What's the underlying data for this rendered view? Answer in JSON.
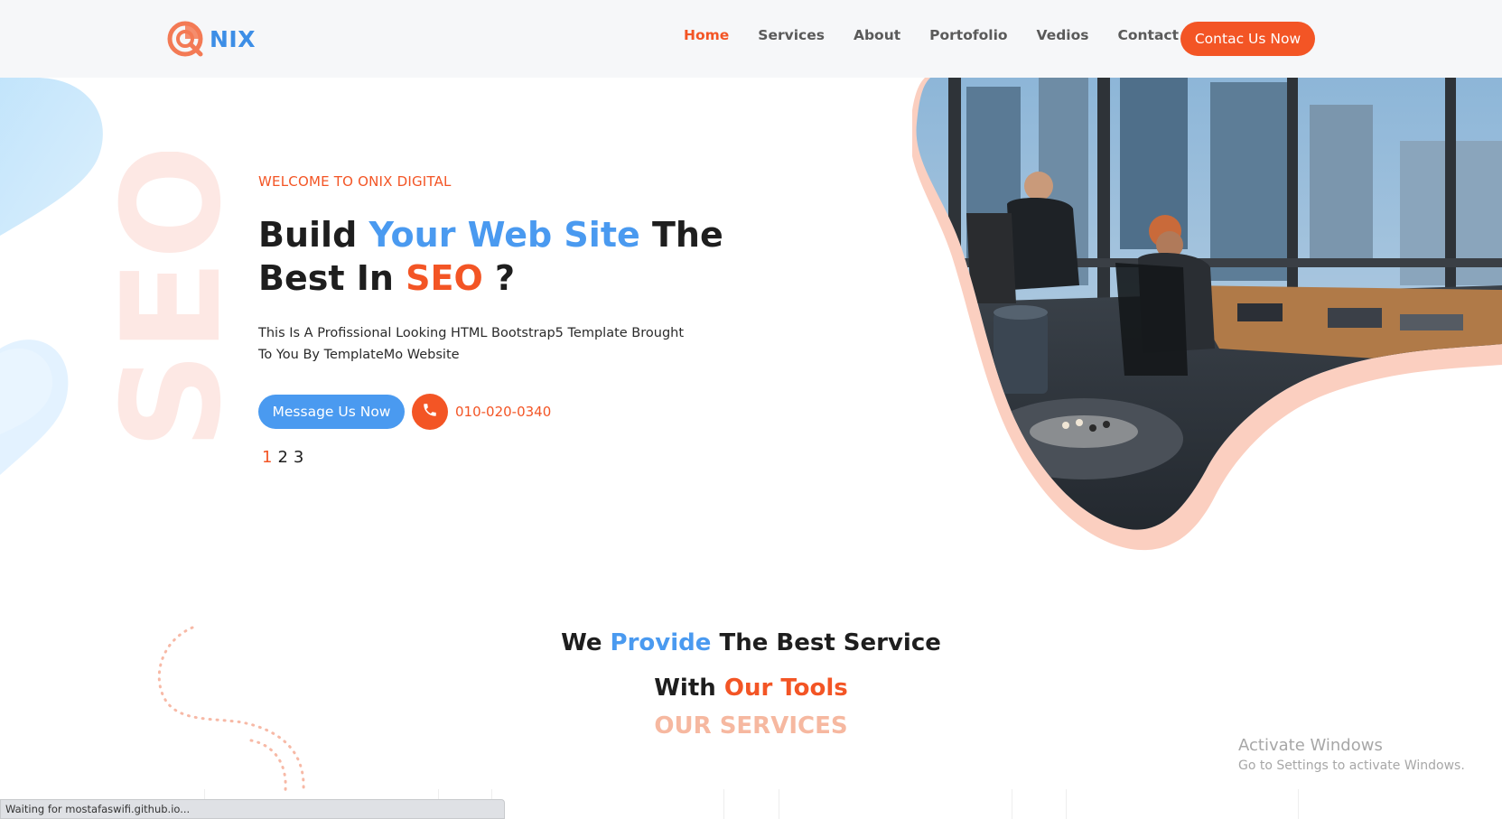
{
  "brand": {
    "logo_text": "NIX",
    "logo_icon": "magnifier-donut-icon"
  },
  "nav": {
    "items": [
      {
        "label": "Home",
        "active": true
      },
      {
        "label": "Services",
        "active": false
      },
      {
        "label": "About",
        "active": false
      },
      {
        "label": "Portofolio",
        "active": false
      },
      {
        "label": "Vedios",
        "active": false
      },
      {
        "label": "Contact Us",
        "active": false
      }
    ],
    "cta_label": "Contac Us Now"
  },
  "hero": {
    "kicker": "WELCOME TO ONIX DIGITAL",
    "headline": {
      "p1": "Build ",
      "p2": "Your Web Site",
      "p3": " The",
      "p4": "Best In ",
      "p5": "SEO",
      "p6": " ?"
    },
    "description": "This Is A Profissional Looking HTML Bootstrap5 Template Brought To You By TemplateMo Website",
    "message_button": "Message Us Now",
    "phone_icon": "phone-icon",
    "phone": "010-020-0340",
    "pager": [
      "1",
      "2",
      "3"
    ],
    "pager_active": "1",
    "background_word": "SEO",
    "image_alt": "office-team-photo"
  },
  "services": {
    "line1": {
      "a": "We ",
      "b": "Provide",
      "c": " The Best Service"
    },
    "line2": {
      "a": "With ",
      "b": "Our Tools"
    },
    "caption": "OUR SERVICES"
  },
  "windows": {
    "title": "Activate Windows",
    "subtitle": "Go to Settings to activate Windows."
  },
  "statusbar": {
    "text": "Waiting for mostafaswifi.github.io..."
  },
  "colors": {
    "accent_orange": "#f35525",
    "accent_blue": "#4a9af0",
    "header_bg": "#f6f7f9"
  }
}
